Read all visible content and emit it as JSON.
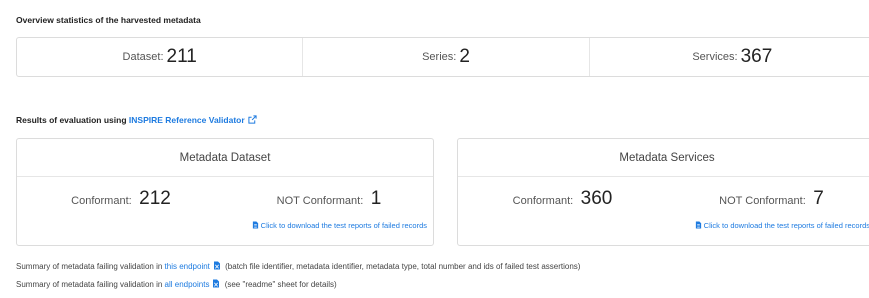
{
  "overview": {
    "title": "Overview statistics of the harvested metadata",
    "stats": [
      {
        "label": "Dataset:",
        "value": "211"
      },
      {
        "label": "Series:",
        "value": "2"
      },
      {
        "label": "Services:",
        "value": "367"
      }
    ]
  },
  "evaluation": {
    "title_prefix": "Results of evaluation using",
    "validator_link": "INSPIRE Reference Validator",
    "panels": [
      {
        "title": "Metadata Dataset",
        "conformant_label": "Conformant:",
        "conformant_value": "212",
        "not_conformant_label": "NOT Conformant:",
        "not_conformant_value": "1",
        "download_link": "Click to download the test reports of failed records"
      },
      {
        "title": "Metadata Services",
        "conformant_label": "Conformant:",
        "conformant_value": "360",
        "not_conformant_label": "NOT Conformant:",
        "not_conformant_value": "7",
        "download_link": "Click to download the test reports of failed records"
      }
    ]
  },
  "summaries": [
    {
      "prefix": "Summary of metadata failing validation in",
      "link": "this endpoint",
      "suffix": "(batch file identifier, metadata identifier, metadata type, total number and ids of failed test assertions)"
    },
    {
      "prefix": "Summary of metadata failing validation in",
      "link": "all endpoints",
      "suffix": "(see \"readme\" sheet for details)"
    }
  ],
  "colors": {
    "link": "#1e7be0",
    "border": "#dcdcdc",
    "excel": "#1e7be0"
  },
  "icons": {
    "external": "external-link-icon",
    "document": "document-icon",
    "spreadsheet": "spreadsheet-icon"
  }
}
